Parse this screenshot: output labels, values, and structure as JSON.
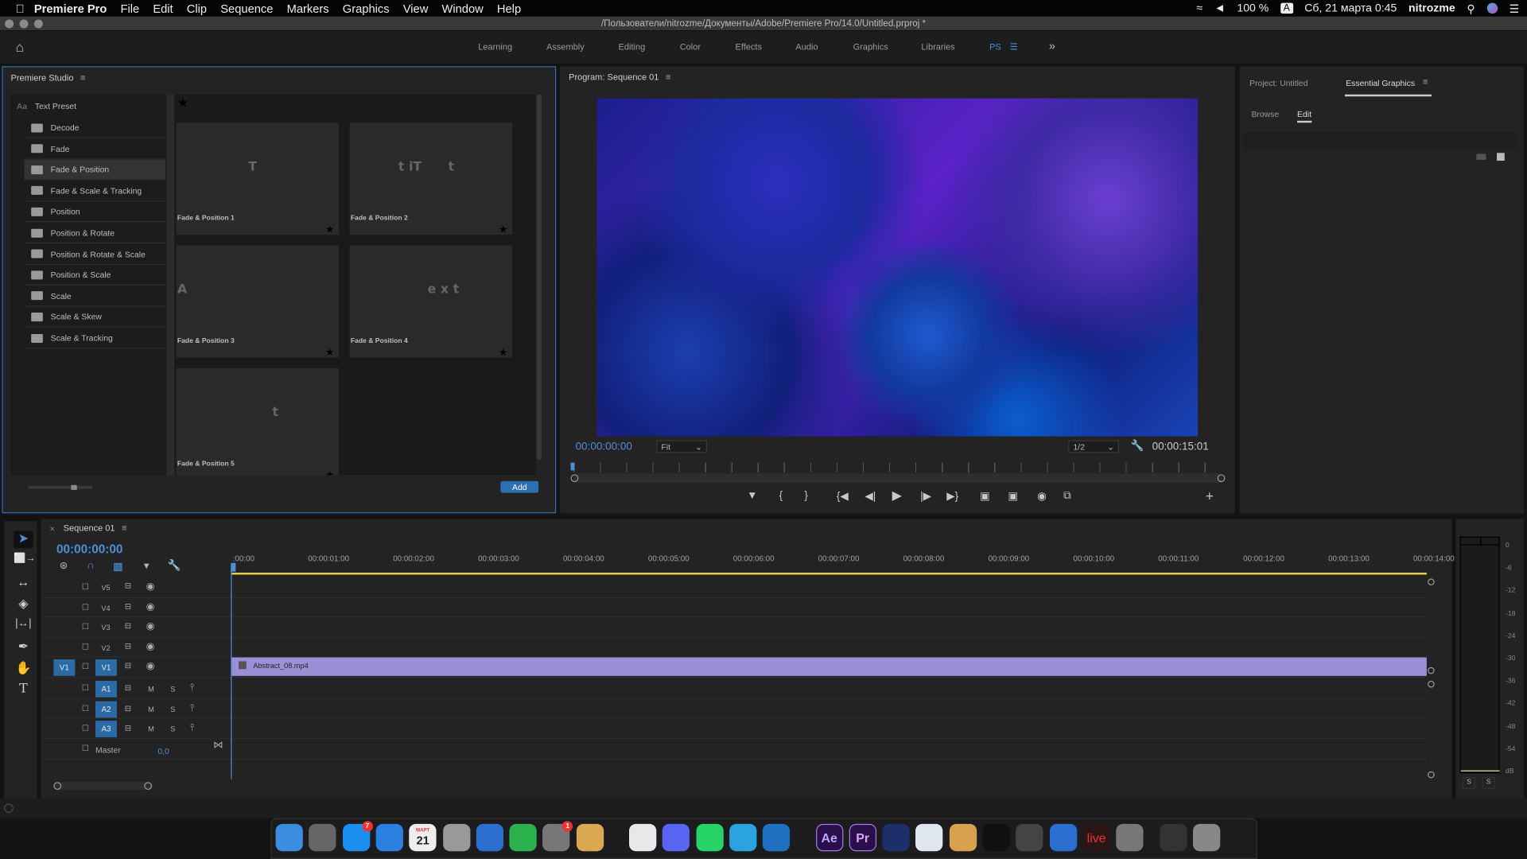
{
  "menubar": {
    "app": "Premiere Pro",
    "items": [
      "File",
      "Edit",
      "Clip",
      "Sequence",
      "Markers",
      "Graphics",
      "View",
      "Window",
      "Help"
    ],
    "battery": "100 %",
    "input": "A",
    "datetime": "Сб, 21 марта  0:45",
    "user": "nitrozme"
  },
  "window": {
    "title": "/Пользователи/nitrozme/Документы/Adobe/Premiere Pro/14.0/Untitled.prproj *"
  },
  "workspaces": {
    "items": [
      "Learning",
      "Assembly",
      "Editing",
      "Color",
      "Effects",
      "Audio",
      "Graphics",
      "Libraries",
      "PS"
    ],
    "active": "PS",
    "more": "»"
  },
  "studio": {
    "title": "Premiere Studio",
    "root": "Text Preset",
    "folders": [
      "Decode",
      "Fade",
      "Fade & Position",
      "Fade & Scale & Tracking",
      "Position",
      "Position & Rotate",
      "Position & Rotate & Scale",
      "Position & Scale",
      "Scale",
      "Scale & Skew",
      "Scale & Tracking"
    ],
    "selected": "Fade & Position",
    "presets": [
      {
        "label": "Fade & Position 1",
        "glyph": "T"
      },
      {
        "label": "Fade & Position 2",
        "glyph": "t iT      t"
      },
      {
        "label": "Fade & Position 3",
        "glyph": "A"
      },
      {
        "label": "Fade & Position 4",
        "glyph": "e x t"
      },
      {
        "label": "Fade & Position 5",
        "glyph": "     t"
      }
    ],
    "add": "Add"
  },
  "program": {
    "title": "Program: Sequence 01",
    "timecode": "00:00:00:00",
    "zoom": "Fit",
    "resolution": "1/2",
    "duration": "00:00:15:01"
  },
  "right": {
    "tabs": [
      "Project: Untitled",
      "Essential Graphics"
    ],
    "active": "Essential Graphics",
    "subtabs": [
      "Browse",
      "Edit"
    ],
    "active_sub": "Edit"
  },
  "timeline": {
    "title": "Sequence 01",
    "timecode": "00:00:00:00",
    "ruler": [
      ":00:00",
      "00:00:01:00",
      "00:00:02:00",
      "00:00:03:00",
      "00:00:04:00",
      "00:00:05:00",
      "00:00:06:00",
      "00:00:07:00",
      "00:00:08:00",
      "00:00:09:00",
      "00:00:10:00",
      "00:00:11:00",
      "00:00:12:00",
      "00:00:13:00",
      "00:00:14:00"
    ],
    "video_tracks": [
      "V5",
      "V4",
      "V3",
      "V2",
      "V1"
    ],
    "audio_tracks": [
      "A1",
      "A2",
      "A3"
    ],
    "source_patch": "V1",
    "master": "Master",
    "master_value": "0,0",
    "mute": "M",
    "solo": "S",
    "clip": {
      "name": "Abstract_08.mp4",
      "track": "V1",
      "start": 0,
      "end": 15.01,
      "color": "#9d8fd6"
    }
  },
  "meter": {
    "scale": [
      "0",
      "-6",
      "-12",
      "-18",
      "-24",
      "-30",
      "-36",
      "-42",
      "-48",
      "-54",
      "dB"
    ],
    "solo": [
      "S",
      "S"
    ]
  },
  "dock": {
    "apps": [
      "Finder",
      "Launchpad",
      "App Store",
      "Safari",
      "Calendar",
      "Notes",
      "Thunderbird",
      "Evernote",
      "System Preferences",
      "CleanMyMac",
      "Chrome",
      "Discord",
      "WhatsApp",
      "Telegram",
      "Trello",
      "Ae",
      "Pr",
      "Cinema 4D",
      "Creative Cloud",
      "Lotion",
      "OBS",
      "Keystroke",
      "Keynote",
      "live",
      "Unknown",
      "Activity Monitor",
      "Trash"
    ],
    "calendar": {
      "month": "МАРТ",
      "day": "21"
    },
    "badges": {
      "App Store": "7",
      "System Preferences": "1"
    }
  },
  "colors": {
    "accent": "#4a90d9",
    "panel": "#232323",
    "clip": "#9d8fd6",
    "track_target": "#2b6aa3",
    "work_area": "#e6d34a"
  }
}
